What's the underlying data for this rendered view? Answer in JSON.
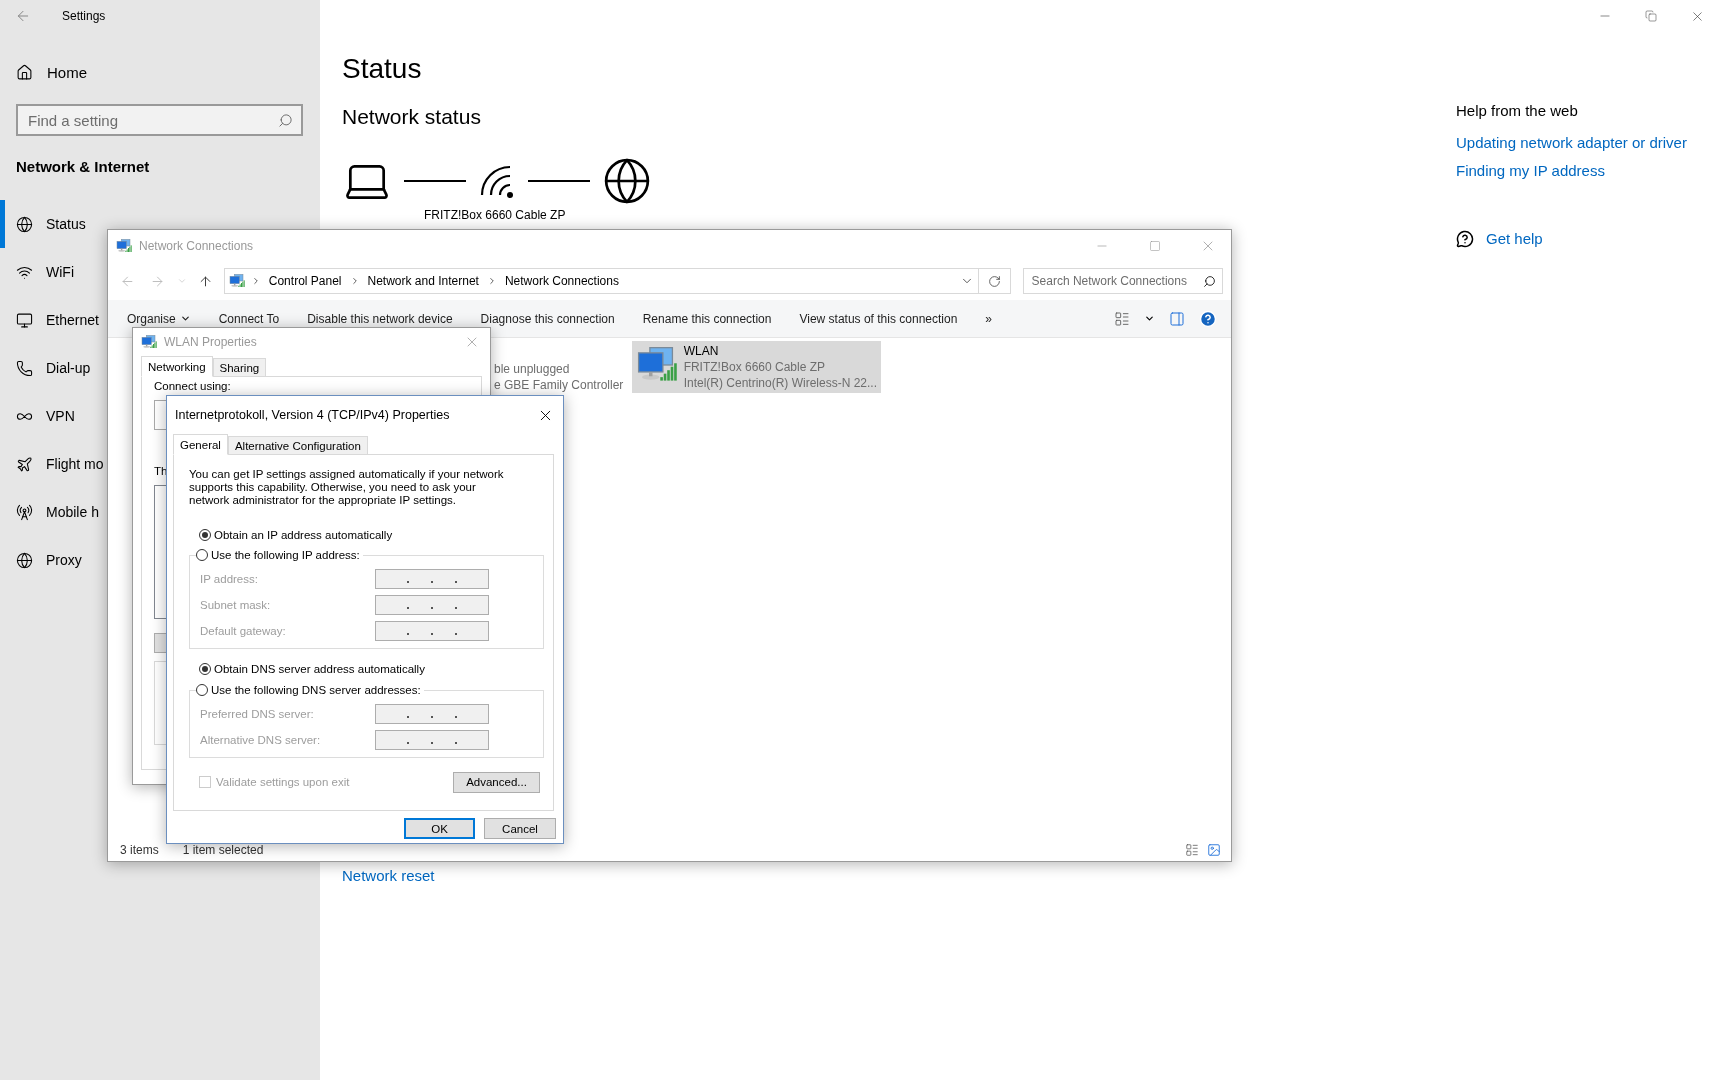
{
  "settings": {
    "title": "Settings",
    "home": "Home",
    "search": {
      "placeholder": "Find a setting"
    },
    "section": "Network & Internet",
    "nav": [
      {
        "label": "Status",
        "selected": true
      },
      {
        "label": "WiFi",
        "selected": false
      },
      {
        "label": "Ethernet",
        "selected": false
      },
      {
        "label": "Dial-up",
        "selected": false
      },
      {
        "label": "VPN",
        "selected": false
      },
      {
        "label": "Flight mo",
        "selected": false
      },
      {
        "label": "Mobile h",
        "selected": false
      },
      {
        "label": "Proxy",
        "selected": false
      }
    ],
    "heading": "Status",
    "subheading": "Network status",
    "router_label": "FRITZ!Box 6660 Cable ZP",
    "reset_link": "Network reset",
    "help": {
      "title": "Help from the web",
      "links": [
        "Updating network adapter or driver",
        "Finding my IP address"
      ],
      "get_help": "Get help"
    }
  },
  "network_connections": {
    "title": "Network Connections",
    "breadcrumbs": [
      "Control Panel",
      "Network and Internet",
      "Network Connections"
    ],
    "search": {
      "placeholder": "Search Network Connections"
    },
    "toolbar": [
      {
        "label": "Organise",
        "dropdown": true
      },
      {
        "label": "Connect To",
        "dropdown": false
      },
      {
        "label": "Disable this network device",
        "dropdown": false
      },
      {
        "label": "Diagnose this connection",
        "dropdown": false
      },
      {
        "label": "Rename this connection",
        "dropdown": false
      },
      {
        "label": "View status of this connection",
        "dropdown": false
      }
    ],
    "more": "»",
    "partial_connection": [
      "ble unplugged",
      "e GBE Family Controller"
    ],
    "connections": [
      {
        "name": "WLAN",
        "network": "FRITZ!Box 6660 Cable ZP",
        "adapter": "Intel(R) Centrino(R) Wireless-N 22...",
        "selected": true
      }
    ],
    "status_bar": [
      "3 items",
      "1 item selected"
    ]
  },
  "wlan_properties": {
    "title": "WLAN Properties",
    "tabs": [
      {
        "label": "Networking",
        "selected": true
      },
      {
        "label": "Sharing",
        "selected": false
      }
    ],
    "connect_label": "Connect using:",
    "items_label": "Th"
  },
  "ipv4_properties": {
    "title": "Internetprotokoll, Version 4 (TCP/IPv4) Properties",
    "tabs": [
      {
        "label": "General",
        "selected": true
      },
      {
        "label": "Alternative Configuration",
        "selected": false
      }
    ],
    "description": "You can get IP settings assigned automatically if your network supports this capability. Otherwise, you need to ask your network administrator for the appropriate IP settings.",
    "ip_options": [
      {
        "label": "Obtain an IP address automatically",
        "selected": true
      },
      {
        "label": "Use the following IP address:",
        "selected": false
      }
    ],
    "ip_fields": [
      "IP address:",
      "Subnet mask:",
      "Default gateway:"
    ],
    "dns_options": [
      {
        "label": "Obtain DNS server address automatically",
        "selected": true
      },
      {
        "label": "Use the following DNS server addresses:",
        "selected": false
      }
    ],
    "dns_fields": [
      "Preferred DNS server:",
      "Alternative DNS server:"
    ],
    "validate": {
      "label": "Validate settings upon exit",
      "checked": false
    },
    "advanced": "Advanced...",
    "buttons": [
      {
        "label": "OK",
        "focused": true
      },
      {
        "label": "Cancel",
        "focused": false
      }
    ]
  }
}
